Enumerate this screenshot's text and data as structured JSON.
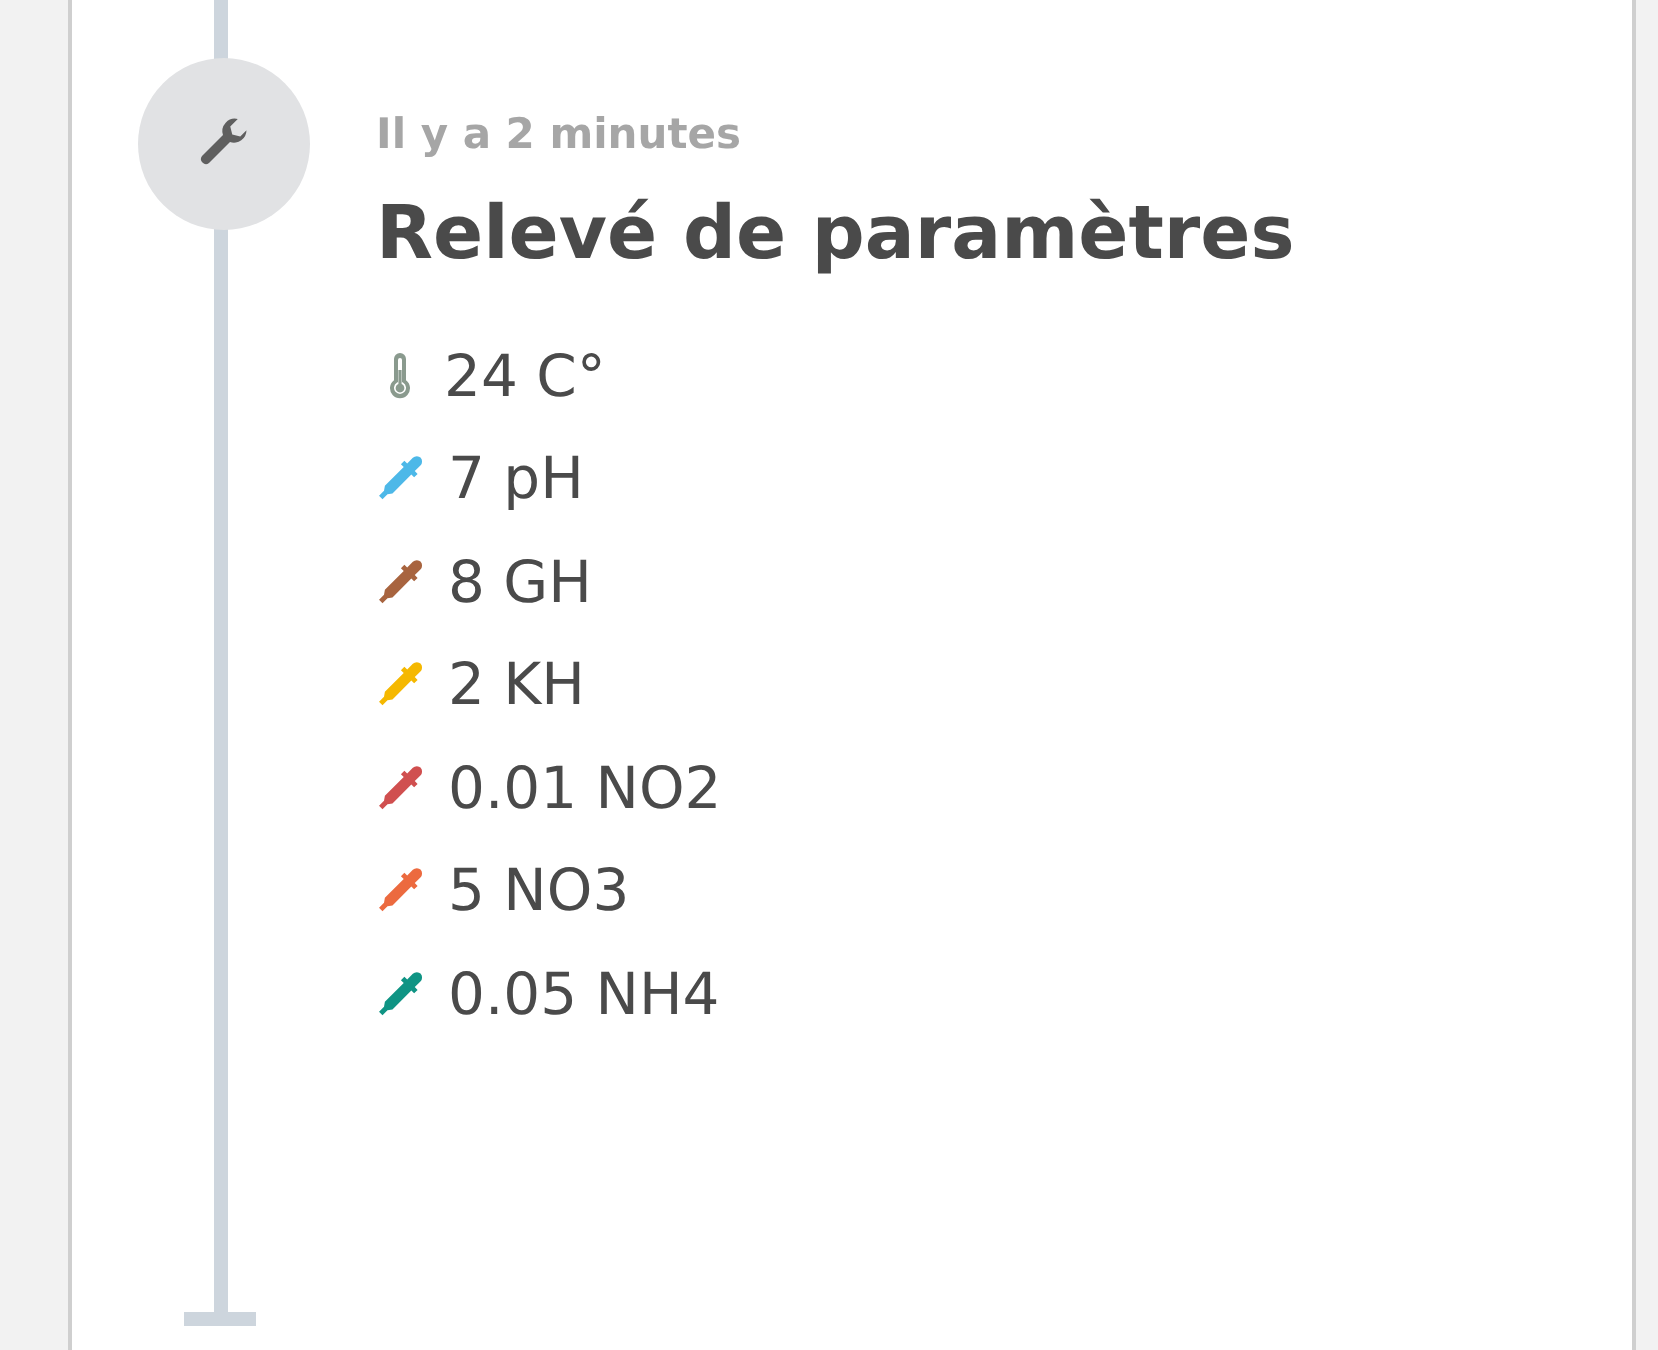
{
  "event": {
    "time": "Il y a 2 minutes",
    "title": "Relevé de paramètres",
    "params": [
      {
        "kind": "thermometer",
        "color": "#8a9a8e",
        "text": "24 C°"
      },
      {
        "kind": "dropper",
        "color": "#4db8e8",
        "text": "7 pH"
      },
      {
        "kind": "dropper",
        "color": "#a8643f",
        "text": "8 GH"
      },
      {
        "kind": "dropper",
        "color": "#f5b800",
        "text": "2 KH"
      },
      {
        "kind": "dropper",
        "color": "#d04f4f",
        "text": "0.01 NO2"
      },
      {
        "kind": "dropper",
        "color": "#ec6a3f",
        "text": "5 NO3"
      },
      {
        "kind": "dropper",
        "color": "#0f9484",
        "text": "0.05 NH4"
      }
    ]
  }
}
